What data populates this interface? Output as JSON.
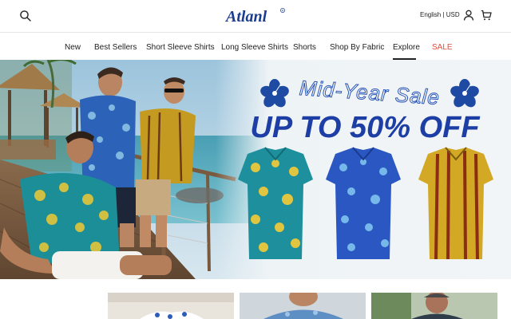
{
  "header": {
    "logo_text": "Atlanl",
    "language_currency": "English | USD",
    "icons": [
      "search-icon",
      "account-icon",
      "cart-icon"
    ]
  },
  "nav": {
    "items": [
      {
        "label": "New"
      },
      {
        "label": "Best Sellers"
      },
      {
        "label": "Short Sleeve Shirts"
      },
      {
        "label": "Long Sleeve Shirts"
      },
      {
        "label": "Shorts"
      },
      {
        "label": "Shop By Fabric"
      },
      {
        "label": "Explore"
      },
      {
        "label": "SALE"
      }
    ],
    "active": "Explore"
  },
  "hero": {
    "headline": "Mid-Year Sale",
    "subheadline": "UP TO 50% OFF",
    "slide_count": 3,
    "active_slide": 2
  },
  "colors": {
    "sale": "#e84c3d",
    "brand_blue": "#1b3d8f",
    "hero_text_blue": "#1d3fa5"
  }
}
